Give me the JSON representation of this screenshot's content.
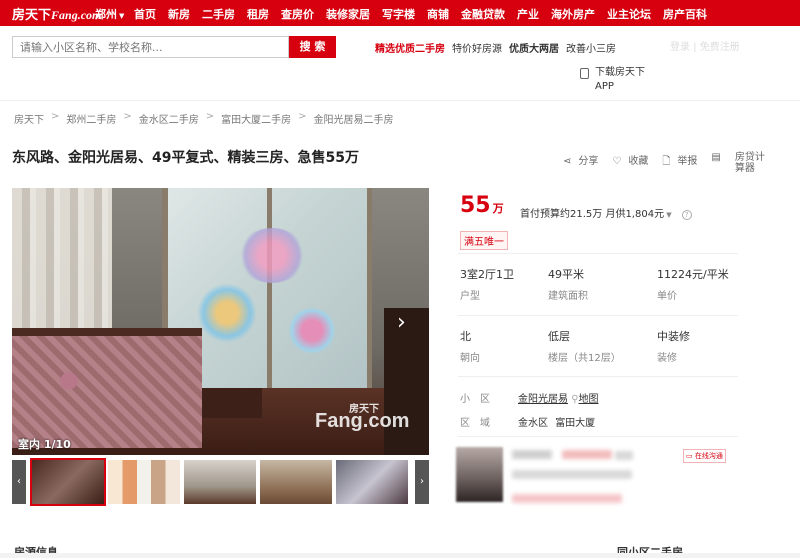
{
  "nav": {
    "logo_text": "房天下",
    "logo_suffix": "Fang.com",
    "city": "郑州",
    "links": [
      "首页",
      "新房",
      "二手房",
      "租房",
      "查房价",
      "装修家居",
      "写字楼",
      "商铺",
      "金融贷款",
      "产业",
      "海外房产",
      "业主论坛",
      "房产百科"
    ]
  },
  "search": {
    "placeholder": "请输入小区名称、学校名称...",
    "button": "搜 索"
  },
  "quick_links": [
    "精选优质二手房",
    "特价好房源",
    "优质大两居",
    "改善小三房"
  ],
  "login": {
    "login_text": "登录",
    "register_text": "免费注册"
  },
  "download": {
    "line1": "下载房天下",
    "line2": "APP"
  },
  "breadcrumb": [
    "房天下",
    "郑州二手房",
    "金水区二手房",
    "富田大厦二手房",
    "金阳光居易二手房"
  ],
  "title": "东风路、金阳光居易、49平复式、精装三房、急售55万",
  "tools": {
    "share": "分享",
    "favorite": "收藏",
    "report": "举报",
    "calc": "房贷计算器"
  },
  "photo": {
    "counter": "室内 1/10",
    "watermark_small": "房天下",
    "watermark_big": "Fang.com"
  },
  "price": {
    "value": "55",
    "unit": "万",
    "payment": "首付预算约21.5万  月供1,804元",
    "tag": "满五唯一"
  },
  "specs": [
    {
      "value": "3室2厅1卫",
      "label": "户型"
    },
    {
      "value": "49平米",
      "label": "建筑面积"
    },
    {
      "value": "11224元/平米",
      "label": "单价"
    },
    {
      "value": "北",
      "label": "朝向"
    },
    {
      "value": "低层",
      "label": "楼层（共12层）"
    },
    {
      "value": "中装修",
      "label": "装修"
    }
  ],
  "community": {
    "label": "小区",
    "name": "金阳光居易",
    "map": "地图"
  },
  "district": {
    "label": "区域",
    "area": "金水区",
    "sub": "富田大厦"
  },
  "agent": {
    "online": "在线沟通"
  },
  "sections": {
    "left": "房源信息",
    "right": "同小区二手房"
  },
  "colors": {
    "brand": "#d6000f"
  }
}
